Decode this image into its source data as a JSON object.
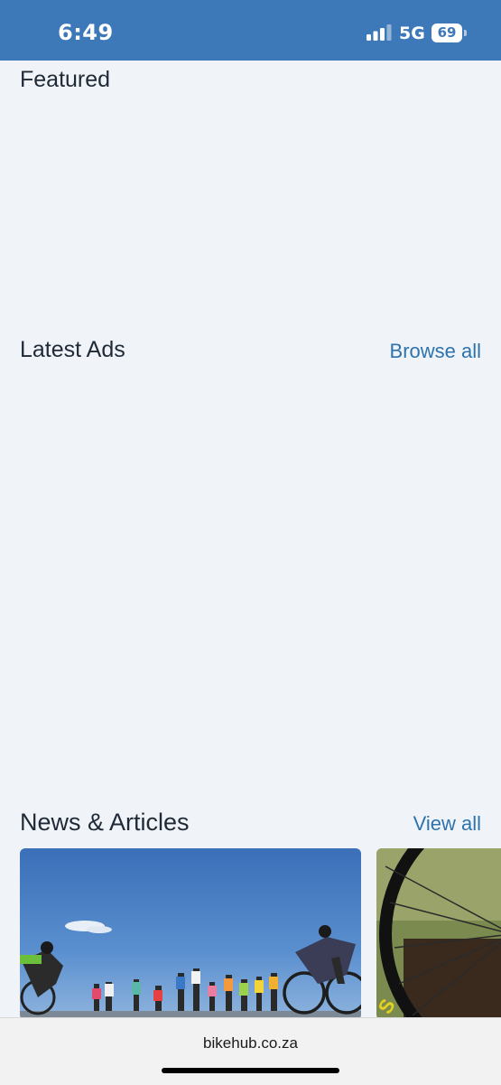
{
  "status_bar": {
    "time": "6:49",
    "network": "5G",
    "battery": "69",
    "background": "#3d79b8"
  },
  "featured": {
    "title": "Featured"
  },
  "latest_ads": {
    "title": "Latest Ads",
    "link_label": "Browse all"
  },
  "news": {
    "title": "News & Articles",
    "link_label": "View all"
  },
  "browser": {
    "url": "bikehub.co.za"
  },
  "colors": {
    "page_background": "#f0f4f9",
    "link": "#2e73ab",
    "heading": "#1f2a36"
  }
}
